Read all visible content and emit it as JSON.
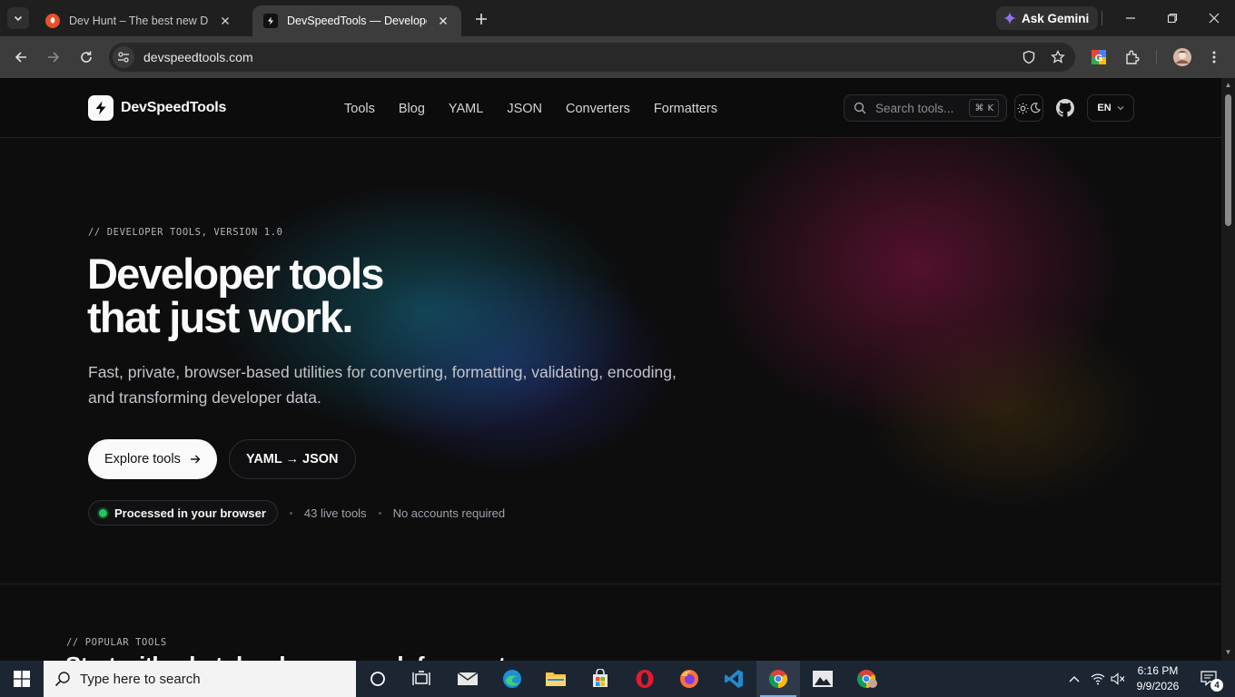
{
  "browser": {
    "tabs": [
      {
        "title": "Dev Hunt – The best new Dev Tools",
        "active": false
      },
      {
        "title": "DevSpeedTools — Developer tools",
        "active": true
      }
    ],
    "ask_gemini": "Ask Gemini",
    "url": "devspeedtools.com"
  },
  "site": {
    "brand": "DevSpeedTools",
    "nav": [
      "Tools",
      "Blog",
      "YAML",
      "JSON",
      "Converters",
      "Formatters"
    ],
    "search_placeholder": "Search tools...",
    "search_shortcut_symbol": "⌘",
    "search_shortcut_key": "K",
    "language": "EN"
  },
  "hero": {
    "eyebrow": "// DEVELOPER TOOLS, VERSION 1.0",
    "title_line1": "Developer tools",
    "title_line2": "that just work.",
    "lead": "Fast, private, browser-based utilities for converting, formatting, validating, encoding, and transforming developer data.",
    "primary_cta": "Explore tools",
    "secondary_cta": "YAML → JSON",
    "badge": "Processed in your browser",
    "meta1": "43 live tools",
    "meta2": "No accounts required"
  },
  "popular": {
    "eyebrow": "// POPULAR TOOLS",
    "heading": "Start with what developers reach for most"
  },
  "taskbar": {
    "search_placeholder": "Type here to search",
    "time": "6:16 PM",
    "date": "9/9/2026",
    "notifications": "4"
  },
  "colors": {
    "accent_green": "#22c55e",
    "page_bg": "#0d0d0e",
    "taskbar_bg": "#1c2633"
  }
}
